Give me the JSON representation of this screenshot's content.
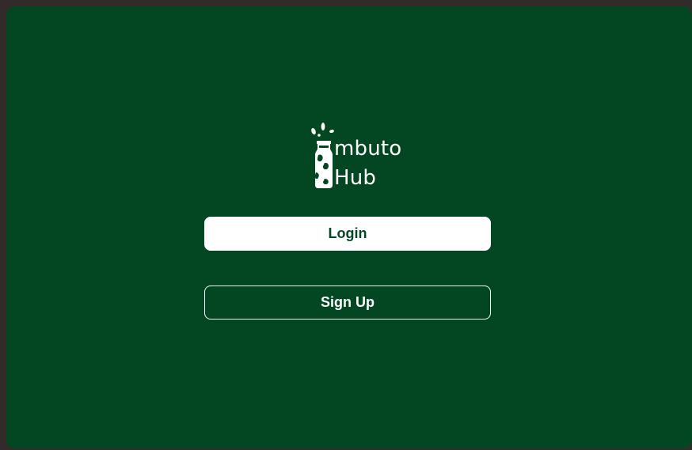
{
  "brand": {
    "line1": "mbuto",
    "line2": "Hub",
    "logo_icon": "milk-bottle-icon"
  },
  "actions": {
    "login_label": "Login",
    "signup_label": "Sign Up"
  },
  "colors": {
    "background": "#024622",
    "outer": "#322b2b",
    "button_fill": "#ffffff",
    "accent_text": "#024622"
  }
}
